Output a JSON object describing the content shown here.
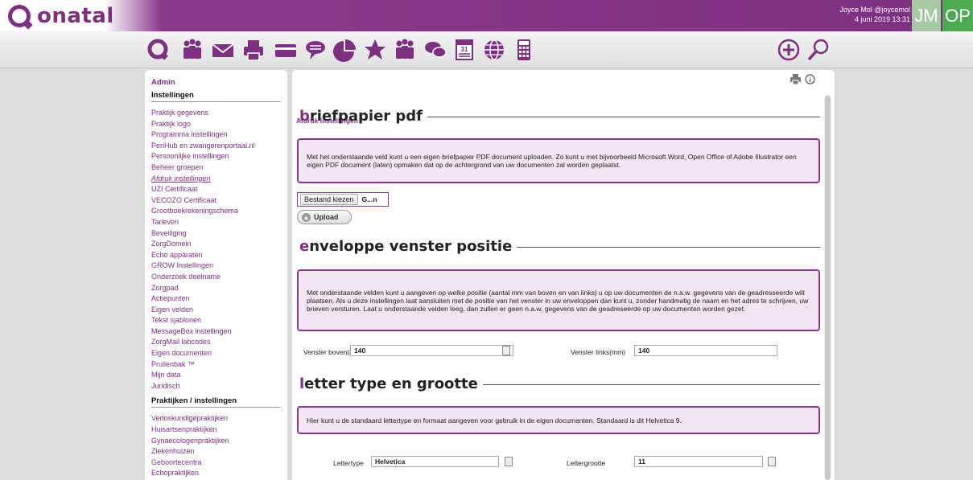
{
  "app": {
    "logo_text": "onatal"
  },
  "user": {
    "name": "Joyce Mol @joycemol",
    "datetime": "4 juni 2019 13:31",
    "avatar_initials": "JM",
    "practice_initials": "OP"
  },
  "colors": {
    "brand": "#7d2f80",
    "info_bg": "#f3e6f3",
    "avatar_jm": "#a7c9a4",
    "avatar_op": "#4caa50"
  },
  "toolbar": {
    "icons": [
      "onatal-logo-icon",
      "clients-icon",
      "mail-icon",
      "print-icon",
      "card-icon",
      "chat-icon",
      "statistics-icon",
      "favorites-icon",
      "team-icon",
      "messages-icon",
      "calendar-icon",
      "globe-icon",
      "calculator-icon"
    ],
    "calendar_day": "31",
    "right_icons": [
      "add-icon",
      "search-icon"
    ]
  },
  "sidebar": {
    "admin_label": "Admin",
    "section1_title": "Instellingen",
    "items": [
      "Praktijk gegevens",
      "Praktijk logo",
      "Programma instellingen",
      "PeriHub en zwangerenportaal.nl",
      "Persoonlijke instellingen",
      "Beheer groepen",
      "Afdruk instellingen",
      "UZI Certificaat",
      "VECOZO Certificaat",
      "Grootboekrekeningschema",
      "Tarieven",
      "Beveiliging",
      "ZorgDomein",
      "Echo apparaten",
      "GROW Instellingen",
      "Onderzoek deelname",
      "Zorgpad",
      "Actiepunten",
      "Eigen velden",
      "Tekst sjablonen",
      "MessageBox instellingen",
      "ZorgMail labcodes",
      "Eigen documenten",
      "Prullenbak ™",
      "Mijn data",
      "Juridisch"
    ],
    "active_index": 6,
    "section2_title": "Praktijken / instellingen",
    "items2": [
      "Verloskundigepraktijken",
      "Huisartsenpraktijken",
      "Gynaecologenpraktijken",
      "Ziekenhuizen",
      "Geboortecentra",
      "Echopraktijken"
    ]
  },
  "main": {
    "page_label": "Afdruk instellingen",
    "sections": [
      {
        "title_first": "b",
        "title_rest": "riefpapier pdf",
        "info": "Met het onderstaande veld kunt u een eigen briefpapier PDF document uploaden. Zo kunt u met bijvoorbeeld Microsoft Word, Open Office of Adobe Illustrator een eigen PDF document (laten) opmaken dat op de achtergrond van uw documenten zal worden geplaatst."
      },
      {
        "title_first": "e",
        "title_rest": "nveloppe venster positie",
        "info": "Met onderstaande velden kunt u aangeven op welke positie (aantal mm van boven en van links) u op uw documenten de n.a.w. gegevens van de geadresseerde wilt plaatsen. Als u deze instellingen laat aansluiten met de positie van het venster in uw enveloppen dan kunt u, zonder handmatig de naam en het adres te schrijven, uw brieven versturen. Laat u onderstaande velden leeg, dan zullen er geen n.a.w. gegevens van de geadreseerde op uw documenten worden gezet."
      },
      {
        "title_first": "l",
        "title_rest": "etter type en grootte",
        "info": "Hier kunt u de standaard lettertype en formaat aangeven voor gebruik in de eigen documenten. Standaard is dit Helvetica 9."
      }
    ],
    "file_button": "Bestand kiezen",
    "file_name": "G...n",
    "upload_label": "Upload",
    "venster_boven_label": "Venster boven(mm)",
    "venster_boven_value": "140",
    "venster_links_label": "Venster links(mm)",
    "venster_links_value": "140",
    "lettertype_label": "Lettertype",
    "lettertype_value": "Helvetica",
    "lettergrootte_label": "Lettergrootte",
    "lettergrootte_value": "11"
  }
}
